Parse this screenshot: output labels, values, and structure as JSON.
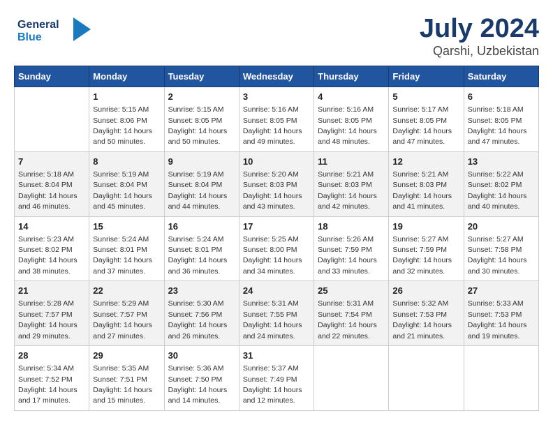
{
  "header": {
    "logo_general": "General",
    "logo_blue": "Blue",
    "title": "July 2024",
    "subtitle": "Qarshi, Uzbekistan"
  },
  "weekdays": [
    "Sunday",
    "Monday",
    "Tuesday",
    "Wednesday",
    "Thursday",
    "Friday",
    "Saturday"
  ],
  "weeks": [
    [
      {
        "day": "",
        "info": ""
      },
      {
        "day": "1",
        "info": "Sunrise: 5:15 AM\nSunset: 8:06 PM\nDaylight: 14 hours\nand 50 minutes."
      },
      {
        "day": "2",
        "info": "Sunrise: 5:15 AM\nSunset: 8:05 PM\nDaylight: 14 hours\nand 50 minutes."
      },
      {
        "day": "3",
        "info": "Sunrise: 5:16 AM\nSunset: 8:05 PM\nDaylight: 14 hours\nand 49 minutes."
      },
      {
        "day": "4",
        "info": "Sunrise: 5:16 AM\nSunset: 8:05 PM\nDaylight: 14 hours\nand 48 minutes."
      },
      {
        "day": "5",
        "info": "Sunrise: 5:17 AM\nSunset: 8:05 PM\nDaylight: 14 hours\nand 47 minutes."
      },
      {
        "day": "6",
        "info": "Sunrise: 5:18 AM\nSunset: 8:05 PM\nDaylight: 14 hours\nand 47 minutes."
      }
    ],
    [
      {
        "day": "7",
        "info": "Sunrise: 5:18 AM\nSunset: 8:04 PM\nDaylight: 14 hours\nand 46 minutes."
      },
      {
        "day": "8",
        "info": "Sunrise: 5:19 AM\nSunset: 8:04 PM\nDaylight: 14 hours\nand 45 minutes."
      },
      {
        "day": "9",
        "info": "Sunrise: 5:19 AM\nSunset: 8:04 PM\nDaylight: 14 hours\nand 44 minutes."
      },
      {
        "day": "10",
        "info": "Sunrise: 5:20 AM\nSunset: 8:03 PM\nDaylight: 14 hours\nand 43 minutes."
      },
      {
        "day": "11",
        "info": "Sunrise: 5:21 AM\nSunset: 8:03 PM\nDaylight: 14 hours\nand 42 minutes."
      },
      {
        "day": "12",
        "info": "Sunrise: 5:21 AM\nSunset: 8:03 PM\nDaylight: 14 hours\nand 41 minutes."
      },
      {
        "day": "13",
        "info": "Sunrise: 5:22 AM\nSunset: 8:02 PM\nDaylight: 14 hours\nand 40 minutes."
      }
    ],
    [
      {
        "day": "14",
        "info": "Sunrise: 5:23 AM\nSunset: 8:02 PM\nDaylight: 14 hours\nand 38 minutes."
      },
      {
        "day": "15",
        "info": "Sunrise: 5:24 AM\nSunset: 8:01 PM\nDaylight: 14 hours\nand 37 minutes."
      },
      {
        "day": "16",
        "info": "Sunrise: 5:24 AM\nSunset: 8:01 PM\nDaylight: 14 hours\nand 36 minutes."
      },
      {
        "day": "17",
        "info": "Sunrise: 5:25 AM\nSunset: 8:00 PM\nDaylight: 14 hours\nand 34 minutes."
      },
      {
        "day": "18",
        "info": "Sunrise: 5:26 AM\nSunset: 7:59 PM\nDaylight: 14 hours\nand 33 minutes."
      },
      {
        "day": "19",
        "info": "Sunrise: 5:27 AM\nSunset: 7:59 PM\nDaylight: 14 hours\nand 32 minutes."
      },
      {
        "day": "20",
        "info": "Sunrise: 5:27 AM\nSunset: 7:58 PM\nDaylight: 14 hours\nand 30 minutes."
      }
    ],
    [
      {
        "day": "21",
        "info": "Sunrise: 5:28 AM\nSunset: 7:57 PM\nDaylight: 14 hours\nand 29 minutes."
      },
      {
        "day": "22",
        "info": "Sunrise: 5:29 AM\nSunset: 7:57 PM\nDaylight: 14 hours\nand 27 minutes."
      },
      {
        "day": "23",
        "info": "Sunrise: 5:30 AM\nSunset: 7:56 PM\nDaylight: 14 hours\nand 26 minutes."
      },
      {
        "day": "24",
        "info": "Sunrise: 5:31 AM\nSunset: 7:55 PM\nDaylight: 14 hours\nand 24 minutes."
      },
      {
        "day": "25",
        "info": "Sunrise: 5:31 AM\nSunset: 7:54 PM\nDaylight: 14 hours\nand 22 minutes."
      },
      {
        "day": "26",
        "info": "Sunrise: 5:32 AM\nSunset: 7:53 PM\nDaylight: 14 hours\nand 21 minutes."
      },
      {
        "day": "27",
        "info": "Sunrise: 5:33 AM\nSunset: 7:53 PM\nDaylight: 14 hours\nand 19 minutes."
      }
    ],
    [
      {
        "day": "28",
        "info": "Sunrise: 5:34 AM\nSunset: 7:52 PM\nDaylight: 14 hours\nand 17 minutes."
      },
      {
        "day": "29",
        "info": "Sunrise: 5:35 AM\nSunset: 7:51 PM\nDaylight: 14 hours\nand 15 minutes."
      },
      {
        "day": "30",
        "info": "Sunrise: 5:36 AM\nSunset: 7:50 PM\nDaylight: 14 hours\nand 14 minutes."
      },
      {
        "day": "31",
        "info": "Sunrise: 5:37 AM\nSunset: 7:49 PM\nDaylight: 14 hours\nand 12 minutes."
      },
      {
        "day": "",
        "info": ""
      },
      {
        "day": "",
        "info": ""
      },
      {
        "day": "",
        "info": ""
      }
    ]
  ]
}
